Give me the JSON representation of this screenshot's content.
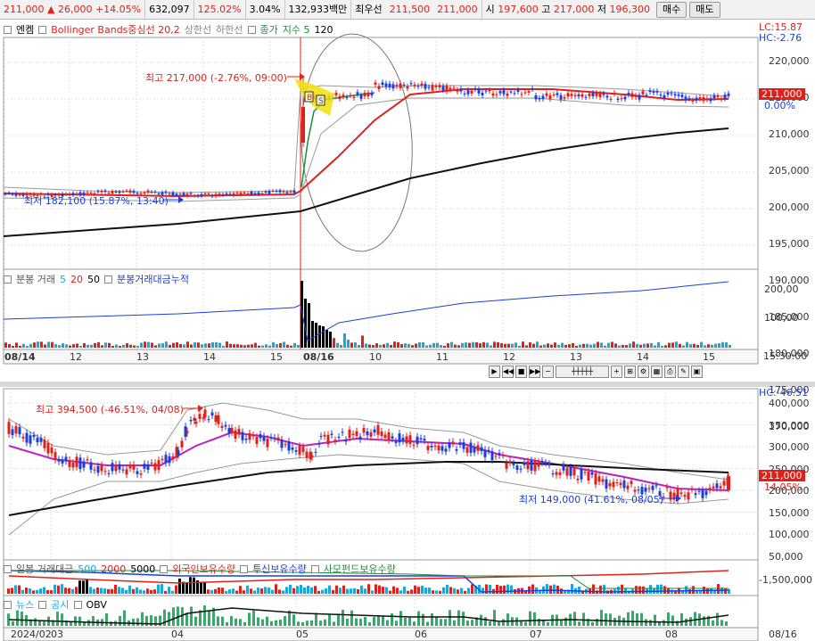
{
  "header": {
    "price": "211,000",
    "arrow": "▲",
    "change": "26,000",
    "change_pct": "+14.05%",
    "volume": "632,097",
    "vol_ratio": "125.02%",
    "turnover": "3.04%",
    "amount": "132,933백만",
    "best_ask_label": "최우선",
    "ask": "211,500",
    "bid": "211,000",
    "open_label": "시",
    "open": "197,600",
    "high_label": "고",
    "high": "217,000",
    "low_label": "저",
    "low": "196,300",
    "buy_btn": "매수",
    "sell_btn": "매도"
  },
  "top_chart": {
    "legend": {
      "tab": "엔켐",
      "bb": "Bollinger Bands중심선 20,2",
      "upper": "상한선",
      "lower": "하한선",
      "price": "종가",
      "index": "지수 5",
      "v120": "120"
    },
    "lc": "LC:15.87",
    "hc": "HC:-2.76",
    "y_ticks": [
      "220,000",
      "215,000",
      "210,000",
      "205,000",
      "200,000",
      "195,000",
      "190,000",
      "185,000",
      "180,000",
      "175,000",
      "170,000"
    ],
    "price_tag": "211,000",
    "zero_tag": "0.00%",
    "high_ann": "최고 217,000 (-2.76%, 09:00)",
    "low_ann": "최저 182,100 (15.87%, 13:40)",
    "markers": [
      "B",
      "S"
    ]
  },
  "top_volume": {
    "legend": {
      "name": "분봉 거래",
      "v5": "5",
      "v20": "20",
      "v50": "50",
      "cum": "분봉거래대금누적"
    },
    "y_ticks": [
      "200,00",
      "100,00"
    ]
  },
  "top_x": {
    "labels": [
      "08/14",
      "12",
      "13",
      "14",
      "15",
      "08/16",
      "10",
      "11",
      "12",
      "13",
      "14",
      "15"
    ],
    "time": "15:30:00"
  },
  "bottom_chart": {
    "hc": "HC:-46.51",
    "y_ticks": [
      "400,000",
      "350,000",
      "300,000",
      "250,000",
      "200,000",
      "150,000",
      "100,000",
      "50,000"
    ],
    "price_tag": "211,000",
    "pct_tag": "14.05%",
    "high_ann": "최고 394,500 (-46.51%, 04/08)",
    "low_ann": "최저 149,000 (41.61%, 08/05)"
  },
  "bottom_volume": {
    "legend": {
      "name": "일봉 거래대금",
      "v500": "500",
      "v2000": "2000",
      "v5000": "5000",
      "foreign": "외국인보유수량",
      "trust": "투신보유수량",
      "fund": "사모펀드보유수량"
    },
    "y_tick": "-1,500,000"
  },
  "bottom_obv": {
    "legend": {
      "news": "뉴스",
      "notice": "공시",
      "obv": "OBV"
    }
  },
  "bottom_x": {
    "labels": [
      "2024/02",
      "03",
      "04",
      "05",
      "06",
      "07",
      "08"
    ],
    "end": "08/16"
  }
}
